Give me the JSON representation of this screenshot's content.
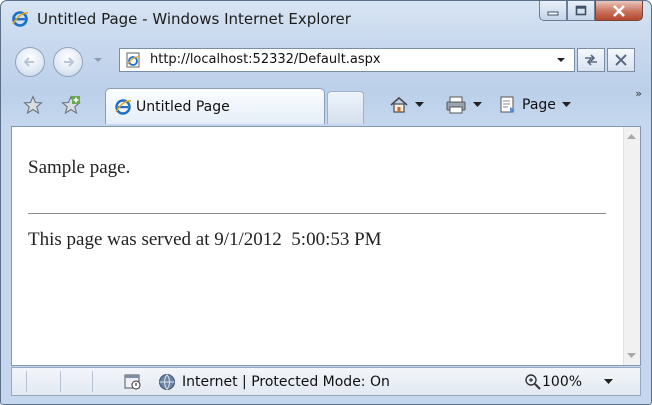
{
  "window": {
    "title": "Untitled Page - Windows Internet Explorer",
    "minimize_icon": "minimize-icon",
    "maximize_icon": "maximize-icon",
    "close_icon": "close-icon"
  },
  "navigation": {
    "address": "http://localhost:52332/Default.aspx",
    "back_icon": "back-arrow-icon",
    "forward_icon": "forward-arrow-icon"
  },
  "tabs": [
    {
      "label": "Untitled Page",
      "icon": "ie-page-icon"
    }
  ],
  "command_bar": {
    "page_label": "Page",
    "home_icon": "home-icon",
    "print_icon": "print-icon",
    "page_icon": "page-icon",
    "overflow_glyph": "»"
  },
  "content": {
    "line1": "Sample page.",
    "line2": "This page was served at 9/1/2012  5:00:53 PM"
  },
  "status_bar": {
    "zone_text": "Internet | Protected Mode: On",
    "zoom": "100%"
  },
  "colors": {
    "chrome_blue": "#c9d9ee",
    "close_red": "#c9725d"
  }
}
